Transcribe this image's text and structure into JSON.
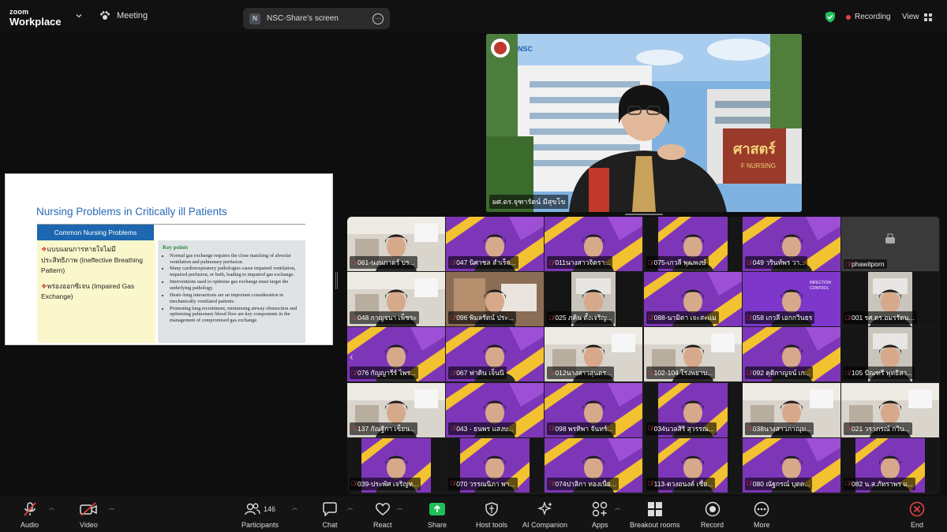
{
  "app": {
    "logo_line1": "zoom",
    "logo_line2": "Workplace",
    "meeting_label": "Meeting"
  },
  "share": {
    "badge": "N",
    "title": "NSC-Share's screen"
  },
  "status": {
    "recording": "Recording",
    "view": "View"
  },
  "slide": {
    "title": "Nursing Problems in Critically ill Patients",
    "band": "Common Nursing  Problems",
    "left_items": [
      "แบบแผนการหายใจไม่มีประสิทธิภาพ (Ineffective Breathing Pattern)",
      "พร่องออกซิเจน (Impaired Gas Exchange)"
    ],
    "key_points_title": "Key points",
    "key_points": [
      "Normal gas exchange requires the close matching of alveolar ventilation and pulmonary perfusion.",
      "Many cardiorespiratory pathologies cause impaired ventilation, impaired perfusion, or both, leading to impaired gas exchange.",
      "Interventions used to optimise gas exchange must target the underlying pathology.",
      "Heart–lung interactions are an important consideration in mechanically ventilated patients.",
      "Promoting lung recruitment, minimising airway obstruction and optimising pulmonary blood flow are key components in the management of compromised gas exchange."
    ]
  },
  "speaker": {
    "name": "ผศ.ดร.จุฑารัตน์ มีสุขโข",
    "logo_text": "NSC",
    "building_text": "ศาสตร์",
    "building_text2": "F NURSING"
  },
  "participants": [
    {
      "name": "061-นงนภาดร์ บร...",
      "bg": "room",
      "muted": true
    },
    {
      "name": "047 นิศาชล สำเร็จ...",
      "bg": "purple",
      "muted": true
    },
    {
      "name": "011นางสาวจิดรา...",
      "bg": "purple",
      "muted": true
    },
    {
      "name": "075-เกวลี พุฒพงษ์",
      "bg": "dark-purple",
      "muted": true
    },
    {
      "name": "049 วรินท์พร วา...",
      "bg": "purple",
      "muted": true
    },
    {
      "name": "phawitporn",
      "bg": "gray",
      "muted": true
    },
    {
      "name": "048 กาญจนา เพ็ชระ",
      "bg": "room",
      "muted": true
    },
    {
      "name": "096 พิมลรัตน์ ประ...",
      "bg": "room2",
      "muted": true
    },
    {
      "name": "025 ภคิน ตั้งเจริญ...",
      "bg": "dark-room",
      "muted": true
    },
    {
      "name": "088-นามิตา เจะสะแม",
      "bg": "purple",
      "muted": true
    },
    {
      "name": "058 เกวลี เอกกวินธร",
      "bg": "slide",
      "muted": true
    },
    {
      "name": "001 รศ.ดร.อมรรัตน...",
      "bg": "dark-room",
      "muted": true
    },
    {
      "name": "076 กัญญารีร์  ไพร...",
      "bg": "purple",
      "muted": true
    },
    {
      "name": "067 ฟาดิน เจ็นนิ",
      "bg": "purple",
      "muted": true
    },
    {
      "name": "012นางสาวสุนดร...",
      "bg": "room",
      "muted": true
    },
    {
      "name": "102-104 โรงพยาบ...",
      "bg": "room",
      "muted": true
    },
    {
      "name": "092 ดุติกาญจน์ เก...",
      "bg": "purple",
      "muted": true
    },
    {
      "name": "105 ปัณฑรี พุทธิสา...",
      "bg": "dark-room",
      "muted": true
    },
    {
      "name": "137 กัณฐิกา เซ็ยน...",
      "bg": "room",
      "muted": true
    },
    {
      "name": "043  - ธนพร แสงบ...",
      "bg": "purple",
      "muted": true
    },
    {
      "name": "098 พรทิพา จันทร์...",
      "bg": "purple",
      "muted": true
    },
    {
      "name": "034นวลสิริ สุวรรณ...",
      "bg": "dark-purple",
      "muted": true
    },
    {
      "name": "038นางสาวภาณุม...",
      "bg": "room",
      "muted": true
    },
    {
      "name": "021 วราภรณ์ กวิน...",
      "bg": "room",
      "muted": true
    },
    {
      "name": "039-ประพัศ เจริญห...",
      "bg": "dark-purple",
      "muted": true
    },
    {
      "name": "070 วรรณนิภา พา...",
      "bg": "dark-purple",
      "muted": true
    },
    {
      "name": "074ปาลิกา ทองเนื่อ...",
      "bg": "purple",
      "muted": true
    },
    {
      "name": "113-ดวงอนงค์ เซื่อ...",
      "bg": "dark-purple",
      "muted": true
    },
    {
      "name": "080 ณัฐกรณ์ บุตต...",
      "bg": "purple",
      "muted": true
    },
    {
      "name": "082 น.ส.ภัทราพร แ...",
      "bg": "dark-purple",
      "muted": true
    }
  ],
  "toolbar": {
    "audio": "Audio",
    "video": "Video",
    "participants": "Participants",
    "participants_count": "146",
    "chat": "Chat",
    "react": "React",
    "share": "Share",
    "host_tools": "Host tools",
    "ai_companion": "AI Companion",
    "apps": "Apps",
    "breakout_rooms": "Breakout rooms",
    "record": "Record",
    "more": "More",
    "end": "End"
  },
  "colors": {
    "accent_green": "#1fbf5a",
    "end_red": "#e04545",
    "tile_purple": "#8a3fc4",
    "tile_yellow": "#f2c230"
  }
}
